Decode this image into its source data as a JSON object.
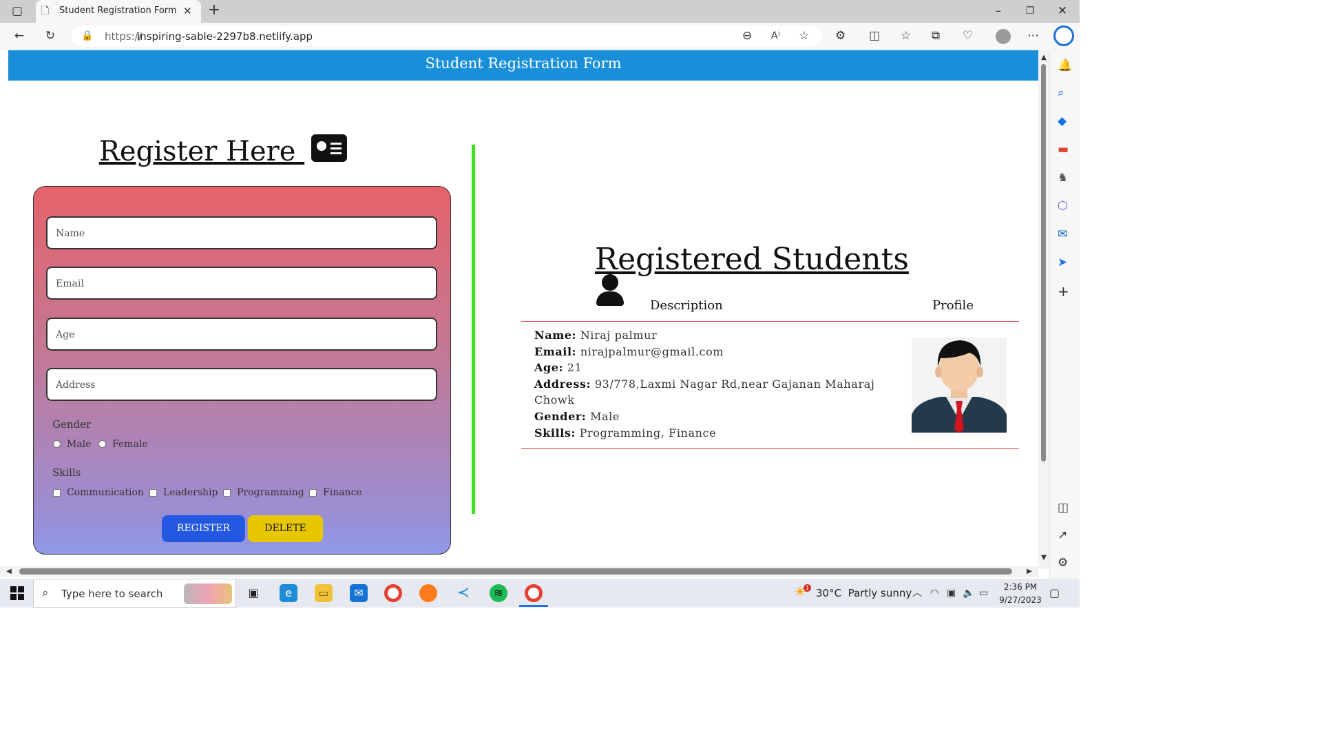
{
  "browser": {
    "tab_title": "Student Registration Form",
    "url_prefix": "https://",
    "url_host": "inspiring-sable-2297b8.netlify.app",
    "read_aloud": "A⁾"
  },
  "page": {
    "header": "Student Registration Form",
    "form": {
      "title": "Register Here",
      "name_placeholder": "Name",
      "email_placeholder": "Email",
      "age_placeholder": "Age",
      "address_placeholder": "Address",
      "gender_label": "Gender",
      "gender_options": [
        "Male",
        "Female"
      ],
      "skills_label": "Skills",
      "skills_options": [
        "Communication",
        "Leadership",
        "Programming",
        "Finance"
      ],
      "register_label": "REGISTER",
      "delete_label": "DELETE"
    },
    "list": {
      "title": "Registered Students",
      "col_description": "Description",
      "col_profile": "Profile",
      "student": {
        "name_key": "Name:",
        "name": "Niraj palmur",
        "email_key": "Email:",
        "email": "nirajpalmur@gmail.com",
        "age_key": "Age:",
        "age": "21",
        "address_key": "Address:",
        "address_line1": "93/778,Laxmi Nagar Rd,near Gajanan Maharaj",
        "address_line2": "Chowk",
        "gender_key": "Gender:",
        "gender": "Male",
        "skills_key": "Skills:",
        "skills": "Programming, Finance"
      }
    }
  },
  "taskbar": {
    "search_placeholder": "Type here to search",
    "weather": "30°C  Partly sunny",
    "time": "2:36 PM",
    "date": "9/27/2023",
    "weather_badge": "1"
  },
  "colors": {
    "header": "#1a8fd9",
    "divider": "#3ce31a",
    "register_button": "#2458e0",
    "delete_button": "#e7c800",
    "table_rule": "#d03a3a"
  }
}
